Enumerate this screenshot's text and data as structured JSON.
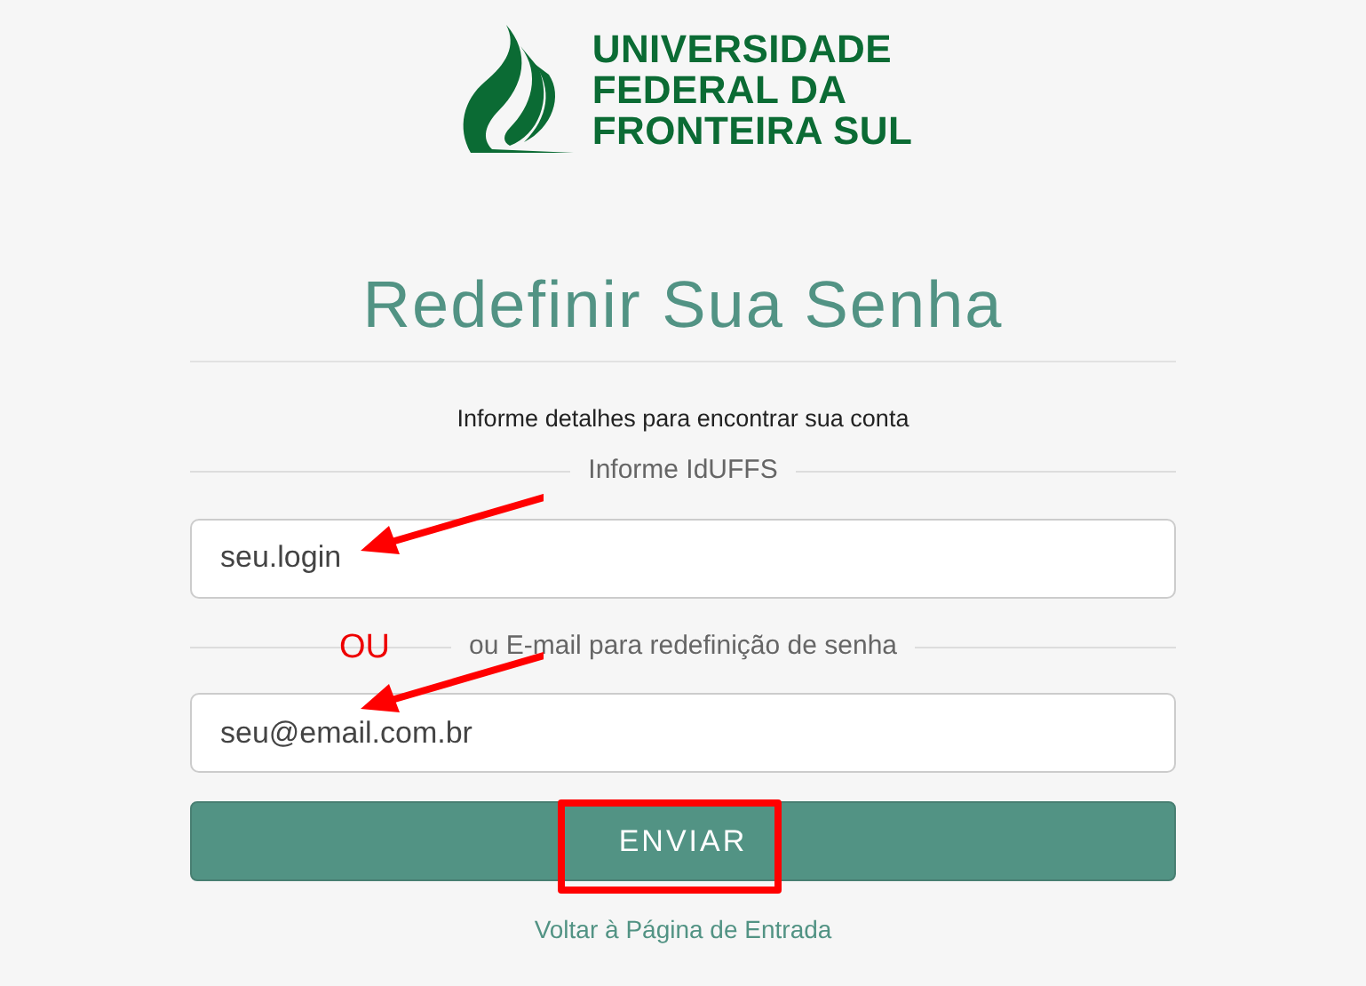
{
  "logo": {
    "lines": [
      "UNIVERSIDADE",
      "FEDERAL DA",
      "FRONTEIRA SUL"
    ]
  },
  "title": "Redefinir Sua Senha",
  "subtitle": "Informe detalhes para encontrar sua conta",
  "fields": [
    {
      "label": "Informe IdUFFS",
      "value": "seu.login"
    },
    {
      "label": "ou E-mail para redefinição de senha",
      "value": "seu@email.com.br"
    }
  ],
  "submit_button": "ENVIAR",
  "back_link": "Voltar à Página de Entrada",
  "annotations": [
    {
      "kind": "arrow"
    },
    {
      "kind": "arrow"
    },
    {
      "kind": "highlight-box"
    },
    {
      "kind": "note",
      "text": "OU"
    }
  ]
}
